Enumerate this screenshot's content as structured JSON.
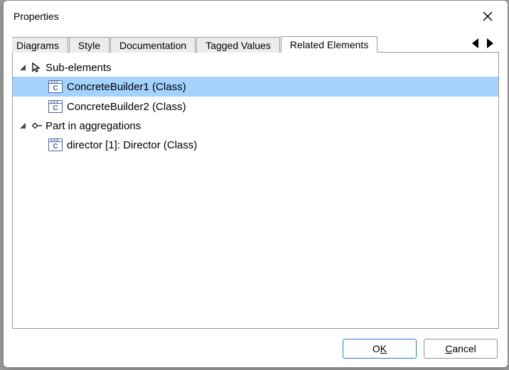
{
  "window": {
    "title": "Properties"
  },
  "tabs": {
    "t0": "Diagrams",
    "t1": "Style",
    "t2": "Documentation",
    "t3": "Tagged Values",
    "t4": "Related Elements"
  },
  "tree": {
    "group1": {
      "label": "Sub-elements",
      "items": [
        "ConcreteBuilder1 (Class)",
        "ConcreteBuilder2 (Class)"
      ]
    },
    "group2": {
      "label": "Part in aggregations",
      "items": [
        "director [1]: Director (Class)"
      ]
    }
  },
  "buttons": {
    "ok_pre": "O",
    "ok_mn": "K",
    "cancel_mn": "C",
    "cancel_post": "ancel"
  }
}
